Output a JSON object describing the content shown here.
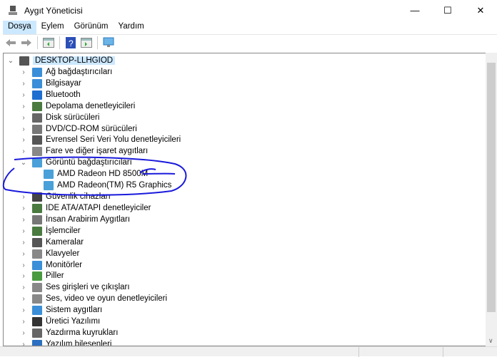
{
  "window": {
    "title": "Aygıt Yöneticisi",
    "minimize": "—",
    "maximize": "☐",
    "close": "✕"
  },
  "menu": [
    "Dosya",
    "Eylem",
    "Görünüm",
    "Yardım"
  ],
  "toolbar": [
    "back-icon",
    "forward-icon",
    "show-hide-console-tree-icon",
    "help-icon",
    "action-pane-icon",
    "scan-hardware-icon"
  ],
  "tree": {
    "root": "DESKTOP-LLHGIOD",
    "items": [
      {
        "label": "Ağ bağdaştırıcıları",
        "color": "#3a8fd8"
      },
      {
        "label": "Bilgisayar",
        "color": "#3a8fd8"
      },
      {
        "label": "Bluetooth",
        "color": "#1e6fd0"
      },
      {
        "label": "Depolama denetleyicileri",
        "color": "#4a7a40"
      },
      {
        "label": "Disk sürücüleri",
        "color": "#666"
      },
      {
        "label": "DVD/CD-ROM sürücüleri",
        "color": "#777"
      },
      {
        "label": "Evrensel Seri Veri Yolu denetleyicileri",
        "color": "#555"
      },
      {
        "label": "Fare ve diğer işaret aygıtları",
        "color": "#888"
      },
      {
        "label": "Görüntü bağdaştırıcıları",
        "color": "#4aa0d8",
        "expanded": true,
        "children": [
          "AMD Radeon HD 8500M",
          "AMD Radeon(TM) R5 Graphics"
        ]
      },
      {
        "label": "Güvenlik cihazları",
        "color": "#444"
      },
      {
        "label": "IDE ATA/ATAPI denetleyiciler",
        "color": "#4a7a40"
      },
      {
        "label": "İnsan Arabirim Aygıtları",
        "color": "#777"
      },
      {
        "label": "İşlemciler",
        "color": "#4a7a40"
      },
      {
        "label": "Kameralar",
        "color": "#555"
      },
      {
        "label": "Klavyeler",
        "color": "#888"
      },
      {
        "label": "Monitörler",
        "color": "#3a8fd8"
      },
      {
        "label": "Piller",
        "color": "#4a9a40"
      },
      {
        "label": "Ses girişleri ve çıkışları",
        "color": "#888"
      },
      {
        "label": "Ses, video ve oyun denetleyicileri",
        "color": "#888"
      },
      {
        "label": "Sistem aygıtları",
        "color": "#3a8fd8"
      },
      {
        "label": "Üretici Yazılımı",
        "color": "#333"
      },
      {
        "label": "Yazdırma kuyrukları",
        "color": "#666"
      },
      {
        "label": "Yazılım bileşenleri",
        "color": "#2a6fc0"
      }
    ]
  },
  "annotation_color": "#1a1adc"
}
